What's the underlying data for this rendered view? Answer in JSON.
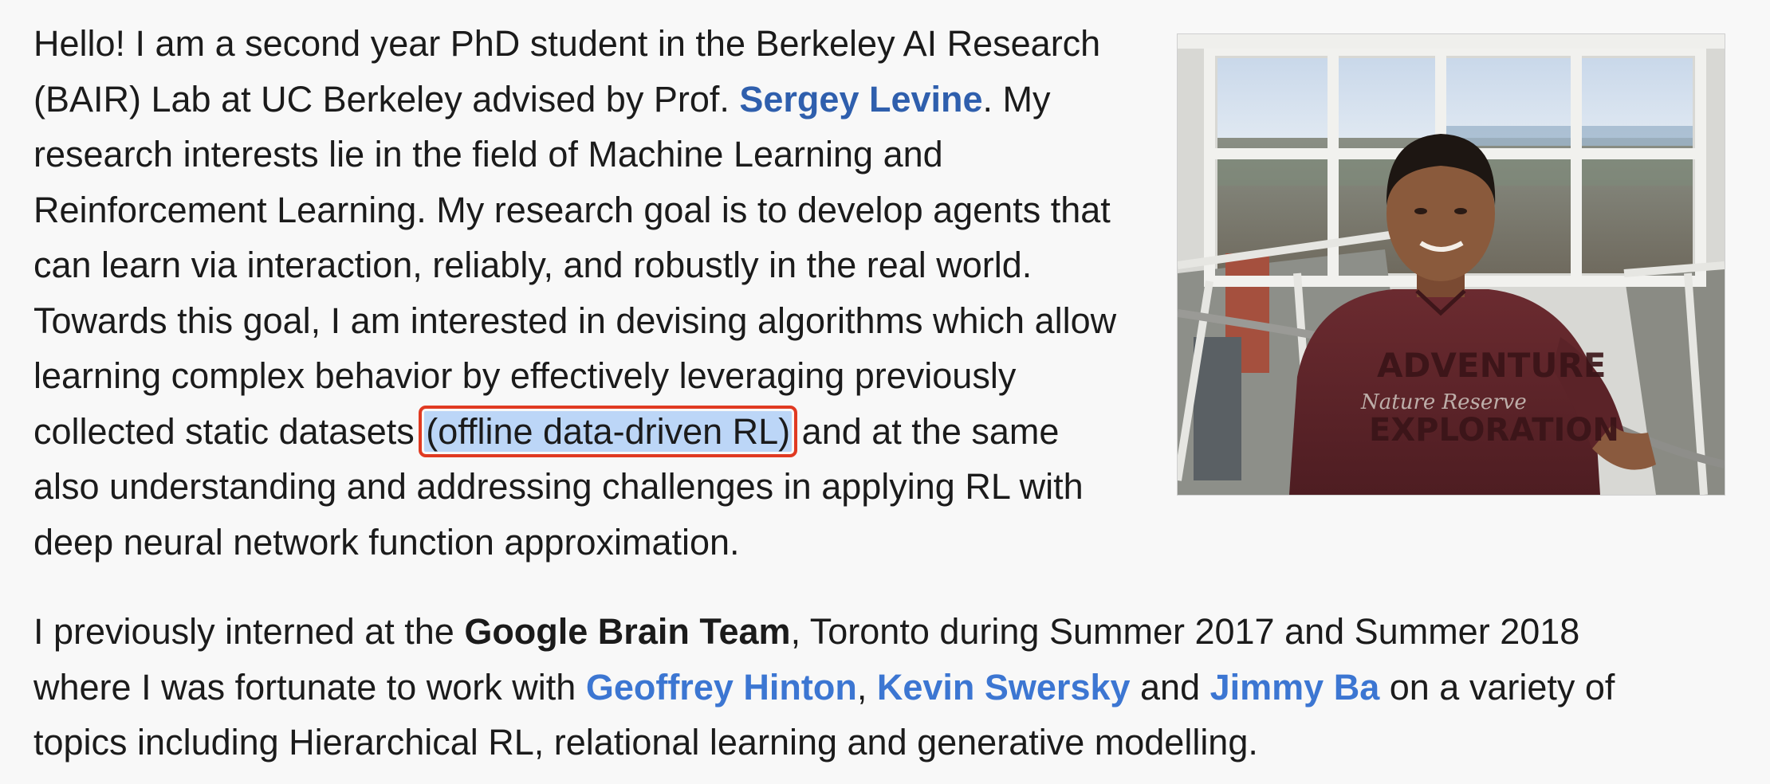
{
  "bio": {
    "line1": "Hello! I am a second year PhD student in the Berkeley AI Research",
    "line2_before": "(BAIR) Lab at UC Berkeley advised by Prof. ",
    "advisor_link": "Sergey Levine",
    "line2_after": ". My",
    "line3": "research interests lie in the field of Machine Learning and",
    "line4": "Reinforcement Learning. My research goal is to develop agents that",
    "line5": "can learn via interaction, reliably, and robustly in the real world.",
    "line6": "Towards this goal, I am interested in devising algorithms which allow",
    "line7": "learning complex behavior by effectively leveraging previously",
    "line8_before": "collected static datasets ",
    "highlighted": "(offline data-driven RL)",
    "line8_after": " and at the same",
    "line9": "also understanding and addressing challenges in applying RL with",
    "line10": "deep neural network function approximation."
  },
  "internship": {
    "line1_before": "I previously interned at the ",
    "team": "Google Brain Team",
    "line1_after": ", Toronto during Summer 2017 and Summer 2018",
    "line2_before": "where I was fortunate to work with ",
    "link1": "Geoffrey Hinton",
    "sep1": ", ",
    "link2": "Kevin Swersky",
    "sep2": " and ",
    "link3": "Jimmy Ba",
    "line2_after": " on a variety of",
    "line3": "topics including Hierarchical RL, relational learning and generative modelling."
  },
  "photo": {
    "shirt_text_1": "ADVENTURE",
    "shirt_text_2": "Nature Reserve",
    "shirt_text_3": "EXPLORATION"
  },
  "colors": {
    "link": "#2f5fad",
    "link_bright": "#3c76d2",
    "selection": "#bcd6f7",
    "highlight_border": "#e03a22"
  }
}
